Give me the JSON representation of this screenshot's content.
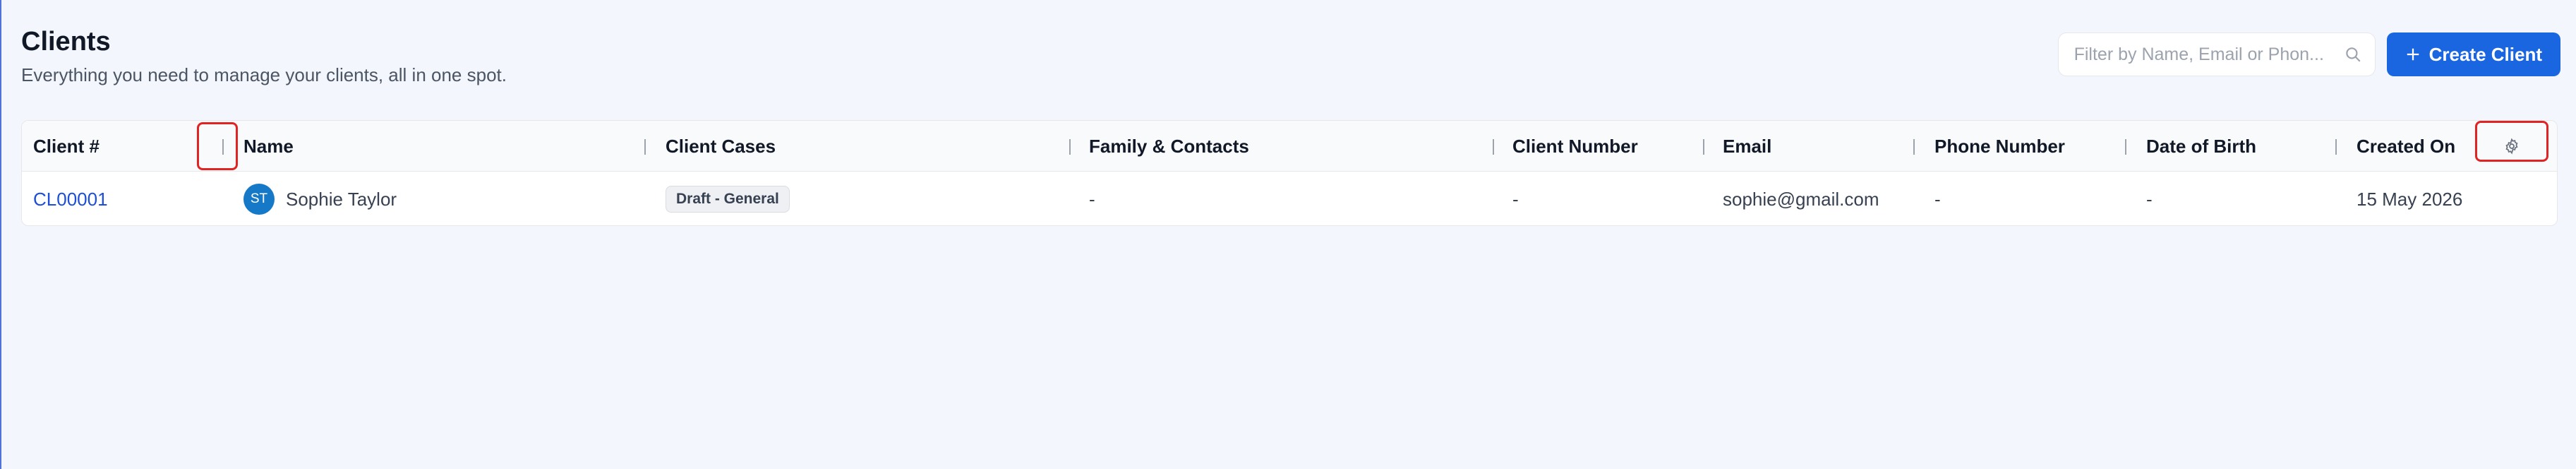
{
  "header": {
    "title": "Clients",
    "subtitle": "Everything you need to manage your clients, all in one spot."
  },
  "toolbar": {
    "search_placeholder": "Filter by Name, Email or Phon...",
    "create_label": "Create Client"
  },
  "table": {
    "columns": [
      "Client #",
      "Name",
      "Client Cases",
      "Family & Contacts",
      "Client Number",
      "Email",
      "Phone Number",
      "Date of Birth",
      "Created On"
    ],
    "rows": [
      {
        "client_id": "CL00001",
        "avatar_initials": "ST",
        "name": "Sophie Taylor",
        "case_badge": "Draft - General",
        "family": "-",
        "client_number": "-",
        "email": "sophie@gmail.com",
        "phone": "-",
        "dob": "-",
        "created_on": "15 May 2026"
      }
    ]
  },
  "colors": {
    "accent": "#1a66e0",
    "link": "#1d4ed8",
    "avatar": "#1679c7",
    "highlight": "#e02424"
  }
}
